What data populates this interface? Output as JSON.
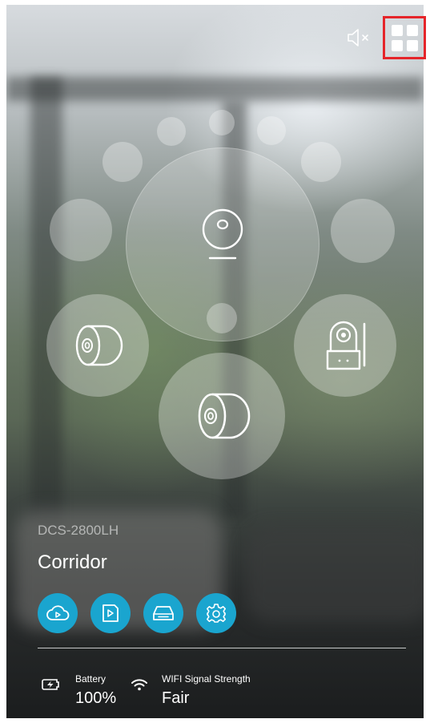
{
  "header": {
    "mute_icon": "speaker-muted-icon",
    "view_toggle_icon": "grid-view-icon"
  },
  "cameras": {
    "selected_icon": "round-camera-icon",
    "left_icon": "cylinder-camera-icon",
    "bottom_icon": "cylinder-camera-icon",
    "right_icon": "pan-tilt-camera-icon"
  },
  "device": {
    "model": "DCS-2800LH",
    "location": "Corridor"
  },
  "actions": [
    {
      "name": "cloud-playback-icon"
    },
    {
      "name": "playback-icon"
    },
    {
      "name": "storage-icon"
    },
    {
      "name": "settings-icon"
    }
  ],
  "status": {
    "battery_label": "Battery",
    "battery_value": "100%",
    "wifi_label": "WIFI Signal Strength",
    "wifi_value": "Fair"
  },
  "colors": {
    "accent": "#1aa5cf",
    "highlight": "#e5252a"
  }
}
